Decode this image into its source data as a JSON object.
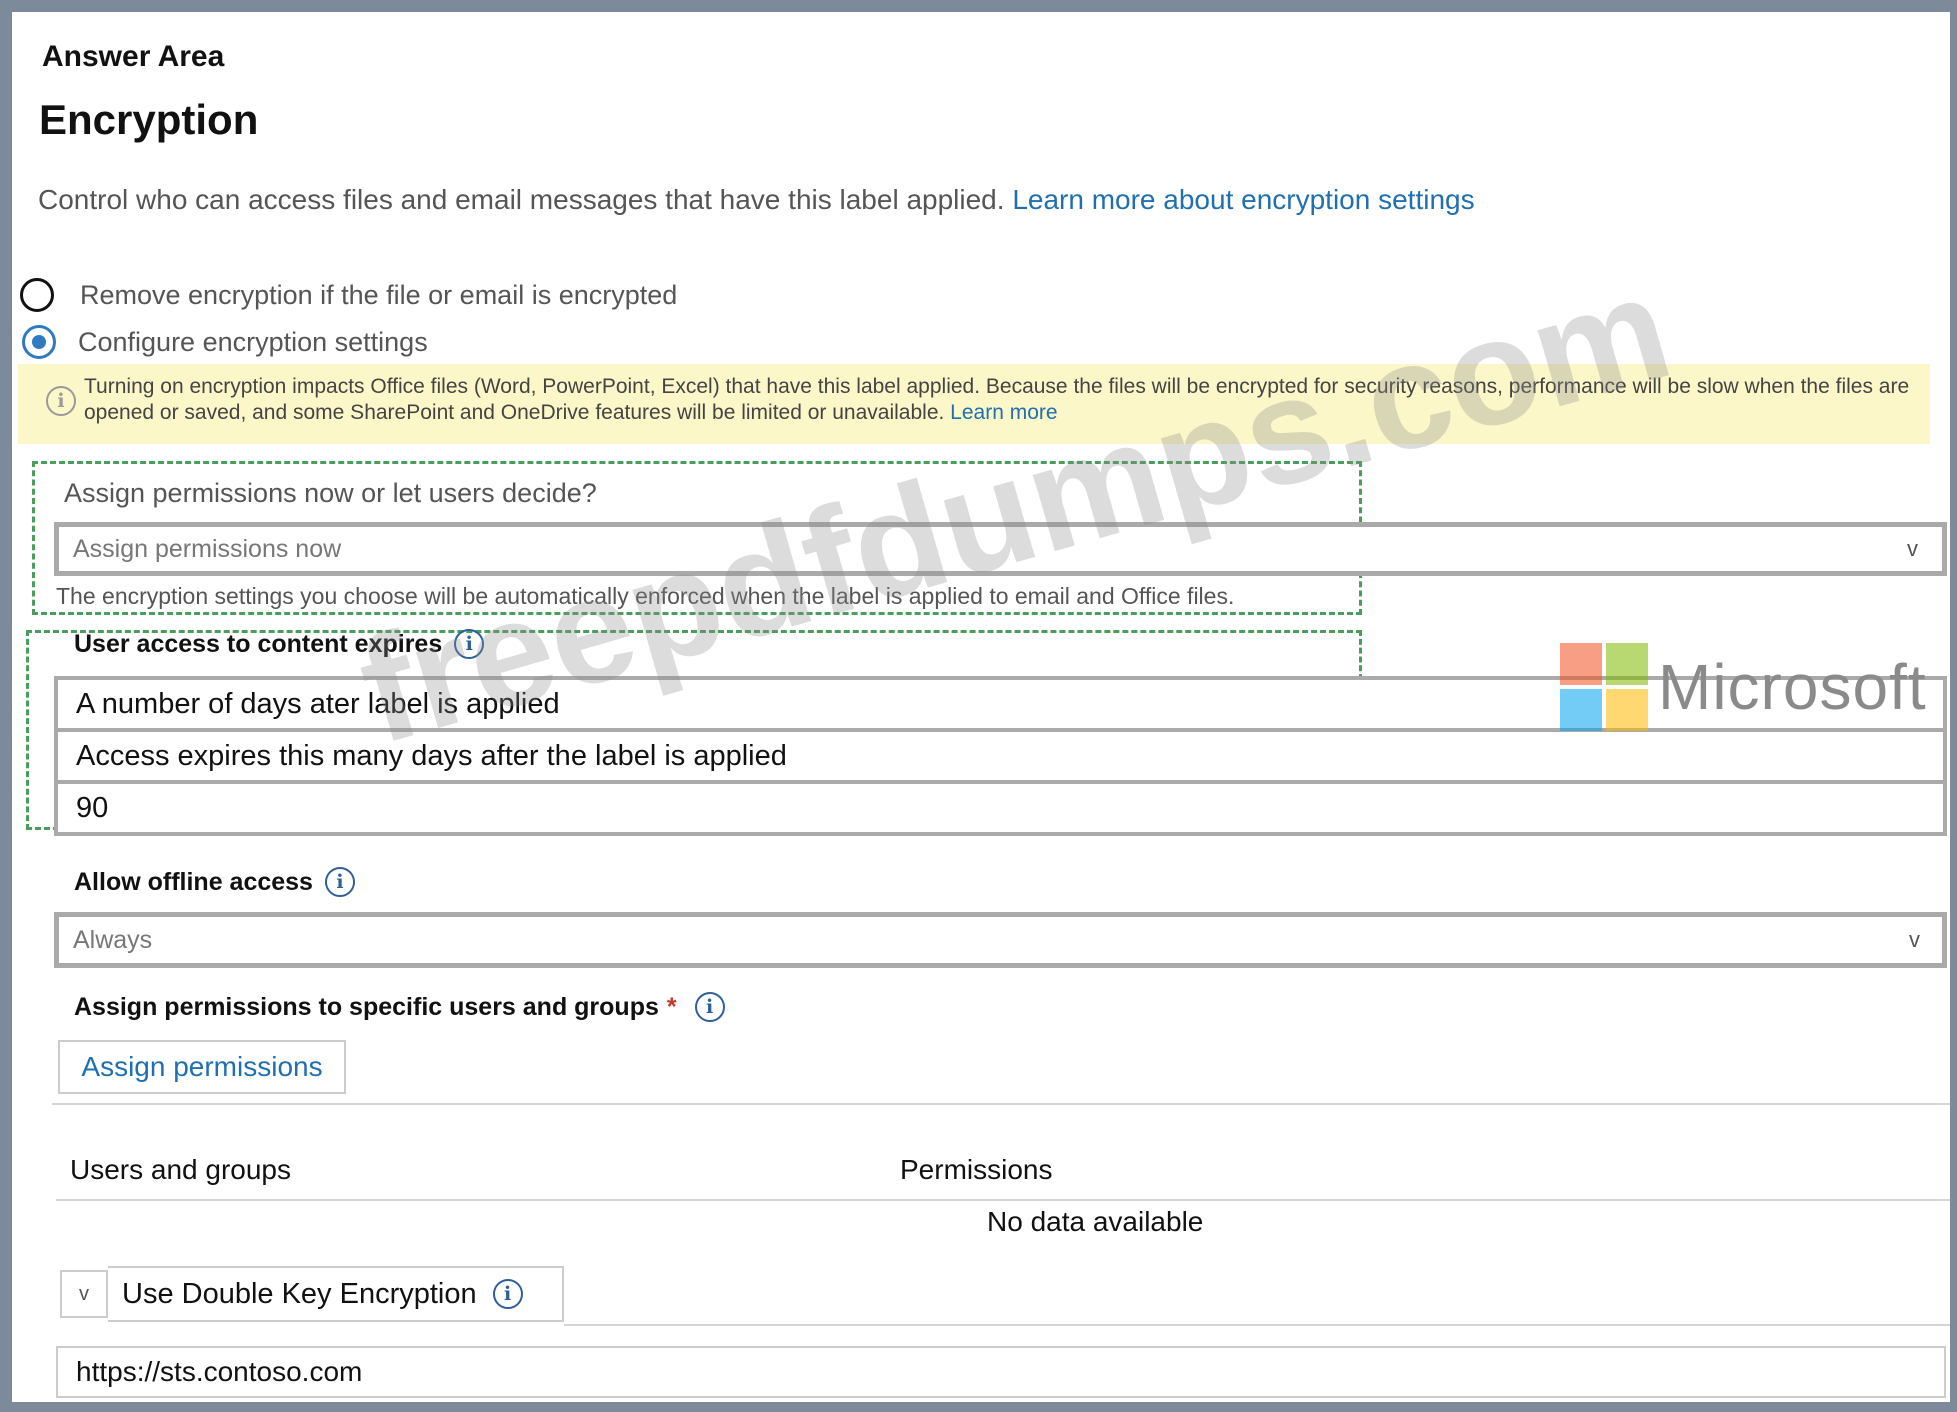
{
  "header": {
    "answer_area": "Answer Area",
    "title": "Encryption",
    "description": "Control who can access files and email messages that have this label applied. ",
    "description_link": "Learn more about encryption settings"
  },
  "encryption_options": {
    "remove_label": "Remove encryption if the file or email is encrypted",
    "configure_label": "Configure encryption settings",
    "selected": "configure"
  },
  "warning": {
    "text": "Turning on encryption impacts Office files (Word, PowerPoint, Excel) that have this label applied. Because the files will be encrypted for security reasons, performance will be slow when the files are opened or saved, and some SharePoint and OneDrive features will be limited or unavailable. ",
    "link": "Learn more"
  },
  "assign_mode": {
    "question": "Assign permissions now or let users decide?",
    "selected": "Assign permissions now",
    "hint": "The encryption settings you choose will be automatically enforced when the label is applied to email and Office files."
  },
  "content_expiry": {
    "label": "User access to content expires",
    "option_1": "A number of days ater label is applied",
    "option_2": "Access expires this many days after the label is applied",
    "days_value": "90"
  },
  "offline_access": {
    "label": "Allow offline access",
    "selected": "Always"
  },
  "permissions": {
    "label": "Assign permissions to specific users and groups",
    "required_mark": "*",
    "button": "Assign permissions",
    "columns": [
      "Users and groups",
      "Permissions"
    ],
    "empty_text": "No data available"
  },
  "double_key": {
    "label": "Use Double Key Encryption",
    "url": "https://sts.contoso.com"
  },
  "icons": {
    "chevron": "v",
    "info": "i"
  },
  "branding": {
    "microsoft_text": "Microsoft",
    "logo_colors": [
      "#f25022",
      "#7fba00",
      "#00a4ef",
      "#ffb900"
    ],
    "watermark": "freepdfdumps.com"
  },
  "colors": {
    "accent": "#2f7bc0",
    "link": "#1f6fb2",
    "warning_bg": "#fbf7c9",
    "dashed_highlight": "#4a9e5c"
  }
}
